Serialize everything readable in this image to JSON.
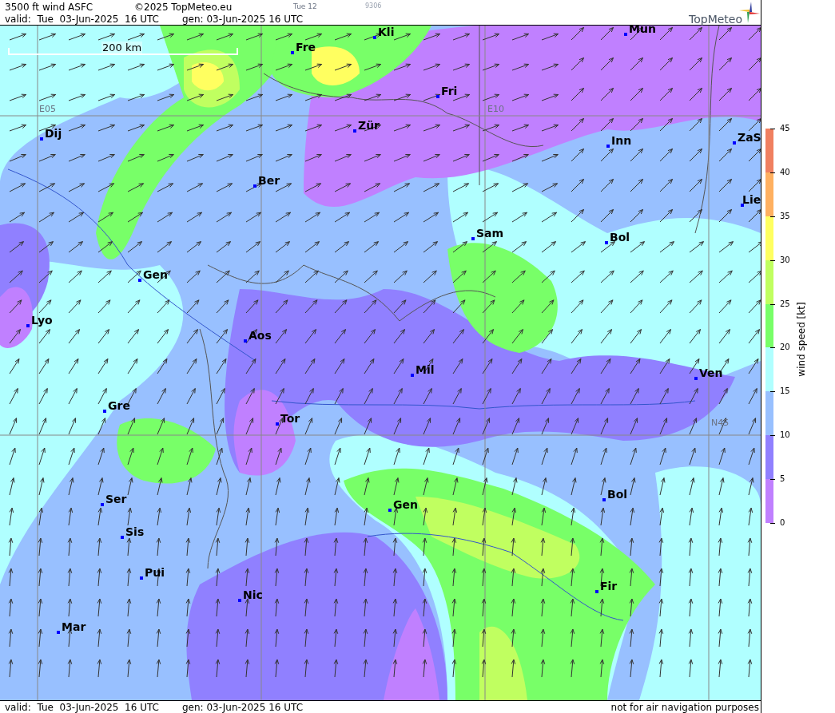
{
  "header": {
    "title": "3500 ft wind ASFC",
    "copyright": "©2025 TopMeteo.eu",
    "run": "Tue 12",
    "code": "9306",
    "valid": "valid:  Tue  03-Jun-2025  16 UTC",
    "generated": "gen: 03-Jun-2025 16 UTC"
  },
  "logo": {
    "text": "TopMeteo"
  },
  "map": {
    "scale_bar": "200 km",
    "grid_labels": [
      "E05",
      "E10",
      "N45"
    ],
    "cities": [
      "Mun",
      "Kli",
      "Fre",
      "Fri",
      "Dij",
      "Zür",
      "Inn",
      "ZaS",
      "Ber",
      "Lie",
      "Sam",
      "Bol",
      "Gen",
      "Lyo",
      "Aos",
      "Mil",
      "Ven",
      "Gre",
      "Tor",
      "Ser",
      "Gen",
      "Bol",
      "Sis",
      "Pui",
      "Nic",
      "Fir",
      "Mar"
    ]
  },
  "legend": {
    "title": "wind speed [kt]",
    "ticks": [
      "45",
      "40",
      "35",
      "30",
      "25",
      "20",
      "15",
      "10",
      "5",
      "0"
    ],
    "bands": [
      {
        "color": "#f08060"
      },
      {
        "color": "#ffb060"
      },
      {
        "color": "#ffff60"
      },
      {
        "color": "#c0ff60"
      },
      {
        "color": "#78ff68"
      },
      {
        "color": "#b0ffff"
      },
      {
        "color": "#98c0ff"
      },
      {
        "color": "#9080ff"
      },
      {
        "color": "#c080ff"
      }
    ]
  },
  "footer": {
    "valid": "valid:  Tue  03-Jun-2025  16 UTC",
    "generated": "gen: 03-Jun-2025 16 UTC",
    "disclaimer": "not for air navigation purposes"
  }
}
